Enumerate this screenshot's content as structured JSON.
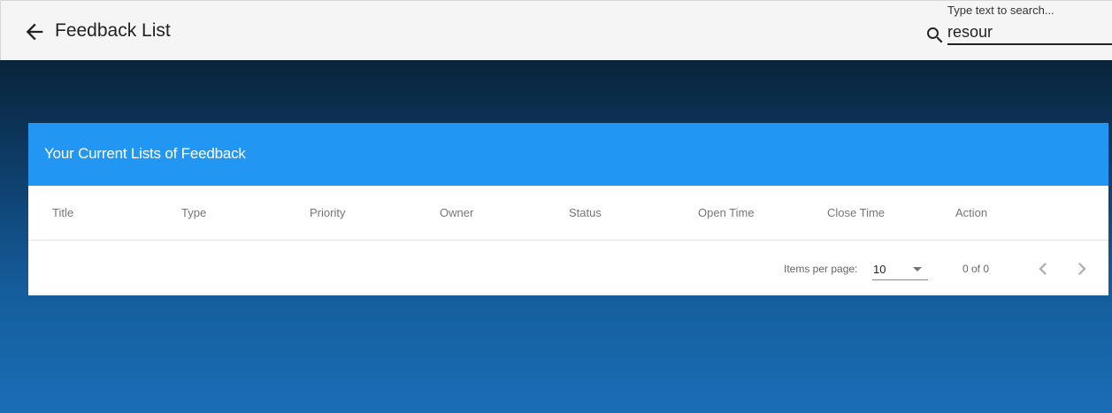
{
  "toolbar": {
    "title": "Feedback List",
    "back_icon": "arrow-left-icon",
    "search": {
      "label": "Type text to search...",
      "value": "resour",
      "icon": "search-icon"
    }
  },
  "card": {
    "title": "Your Current Lists of Feedback",
    "columns": [
      "Title",
      "Type",
      "Priority",
      "Owner",
      "Status",
      "Open Time",
      "Close Time",
      "Action"
    ],
    "rows": []
  },
  "paginator": {
    "items_per_page_label": "Items per page:",
    "items_per_page_value": "10",
    "range_label": "0 of 0",
    "prev_icon": "chevron-left-icon",
    "next_icon": "chevron-right-icon"
  },
  "colors": {
    "toolbar_bg": "#f5f5f5",
    "card_header": "#2196f3",
    "background_top": "#041424",
    "background_bottom": "#1a6db6"
  }
}
